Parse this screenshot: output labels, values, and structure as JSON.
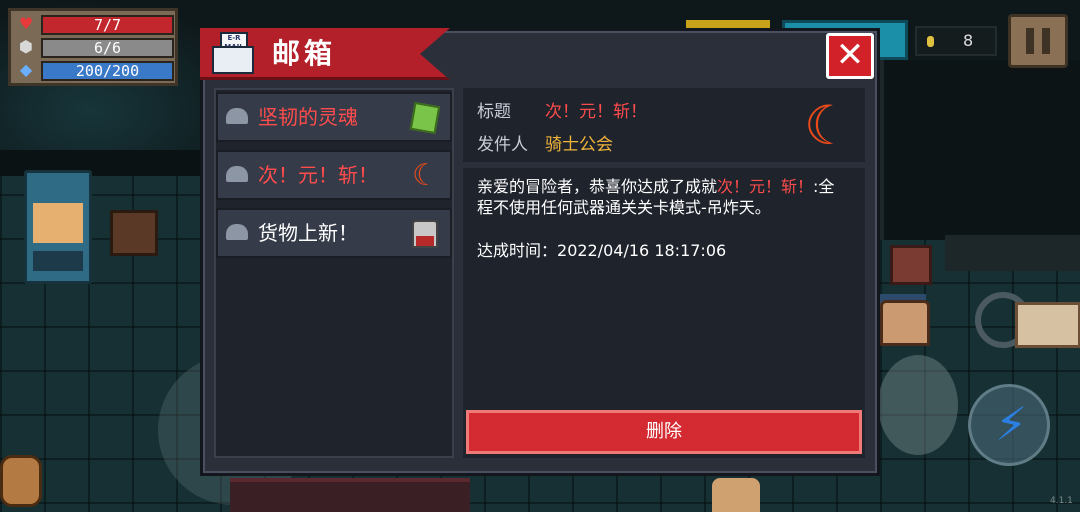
{
  "hud": {
    "hp": "7/7",
    "armor": "6/6",
    "energy": "200/200",
    "coins": "8",
    "version": "4.1.1"
  },
  "mailbox": {
    "title": "邮箱",
    "close_glyph": "✕",
    "icon_text": "E-R\nMAIL",
    "items": [
      {
        "label": "坚韧的灵魂",
        "thumb": "green-book-icon",
        "color": "#ff4c4c"
      },
      {
        "label": "次！元！斩！",
        "thumb": "crescent-moon-icon",
        "color": "#ff4c4c"
      },
      {
        "label": "货物上新！",
        "thumb": "cat-merchant-icon",
        "color": "#ffffff"
      }
    ],
    "detail": {
      "subject_label": "标题",
      "subject_value": "次！元！斩！",
      "sender_label": "发件人",
      "sender_value": "骑士公会",
      "body_prefix": "亲爱的冒险者，恭喜你达成了成就",
      "body_achievement": "次！元！斩！",
      "body_suffix": ":全程不使用任何武器通关关卡模式-吊炸天。",
      "time_label": "达成时间：",
      "time_value": "2022/04/16 18:17:06",
      "delete_label": "删除"
    }
  },
  "colors": {
    "accent_red": "#d42a32",
    "highlight_red": "#ff4c4c",
    "sender_orange": "#f2b43a",
    "panel_bg": "#2a2f3a"
  }
}
